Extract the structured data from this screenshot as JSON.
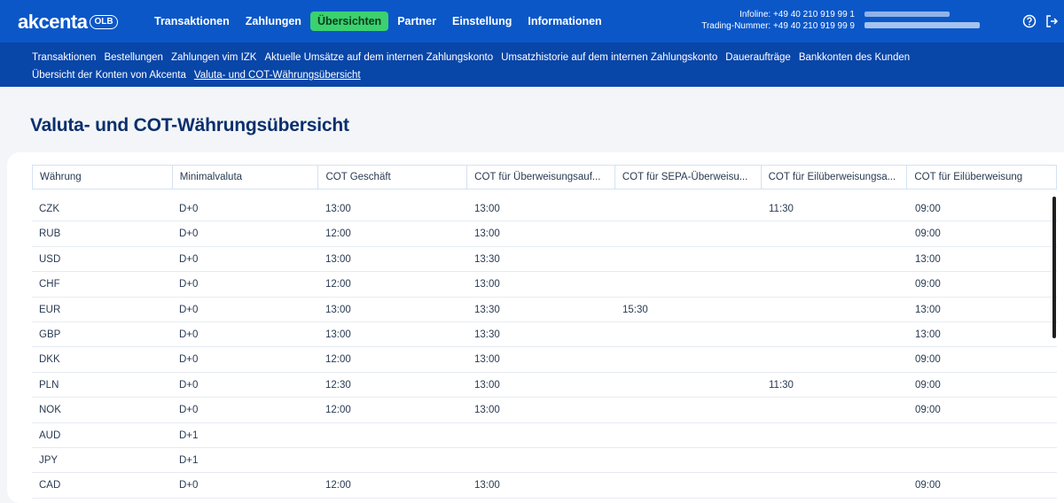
{
  "brand": {
    "logo": "akcenta",
    "badge": "OLB",
    "accent": "#0b57c8",
    "active_tab_color": "#3bd16f"
  },
  "main_nav": [
    {
      "label": "Transaktionen",
      "active": false
    },
    {
      "label": "Zahlungen",
      "active": false
    },
    {
      "label": "Übersichten",
      "active": true
    },
    {
      "label": "Partner",
      "active": false
    },
    {
      "label": "Einstellung",
      "active": false
    },
    {
      "label": "Informationen",
      "active": false
    }
  ],
  "contact": {
    "infoline": "Infoline: +49 40 210 919 99 1",
    "trading": "Trading-Nummer: +49 40 210 919 99 9"
  },
  "icons": {
    "help": "help-icon",
    "logout": "logout-icon"
  },
  "sub_nav": {
    "row1": [
      "Transaktionen",
      "Bestellungen",
      "Zahlungen vim IZK",
      "Aktuelle Umsätze auf dem internen Zahlungskonto",
      "Umsatzhistorie auf dem internen Zahlungskonto",
      "Daueraufträge",
      "Bankkonten des Kunden"
    ],
    "row2": [
      "Übersicht der Konten von Akcenta",
      "Valuta- und COT-Währungsübersicht"
    ],
    "current": "Valuta- und COT-Währungsübersicht"
  },
  "page_title": "Valuta- und COT-Währungsübersicht",
  "table": {
    "headers": [
      "Währung",
      "Minimalvaluta",
      "COT Geschäft",
      "COT für Überweisungsauf...",
      "COT für SEPA-Überweisu...",
      "COT für Eilüberweisungsa...",
      "COT für Eilüberweisung"
    ],
    "rows": [
      [
        "CZK",
        "D+0",
        "13:00",
        "13:00",
        "",
        "11:30",
        "09:00"
      ],
      [
        "RUB",
        "D+0",
        "12:00",
        "13:00",
        "",
        "",
        "09:00"
      ],
      [
        "USD",
        "D+0",
        "13:00",
        "13:30",
        "",
        "",
        "13:00"
      ],
      [
        "CHF",
        "D+0",
        "12:00",
        "13:00",
        "",
        "",
        "09:00"
      ],
      [
        "EUR",
        "D+0",
        "13:00",
        "13:30",
        "15:30",
        "",
        "13:00"
      ],
      [
        "GBP",
        "D+0",
        "13:00",
        "13:30",
        "",
        "",
        "13:00"
      ],
      [
        "DKK",
        "D+0",
        "12:00",
        "13:00",
        "",
        "",
        "09:00"
      ],
      [
        "PLN",
        "D+0",
        "12:30",
        "13:00",
        "",
        "11:30",
        "09:00"
      ],
      [
        "NOK",
        "D+0",
        "12:00",
        "13:00",
        "",
        "",
        "09:00"
      ],
      [
        "AUD",
        "D+1",
        "",
        "",
        "",
        "",
        ""
      ],
      [
        "JPY",
        "D+1",
        "",
        "",
        "",
        "",
        ""
      ],
      [
        "CAD",
        "D+0",
        "12:00",
        "13:00",
        "",
        "",
        "09:00"
      ]
    ]
  }
}
